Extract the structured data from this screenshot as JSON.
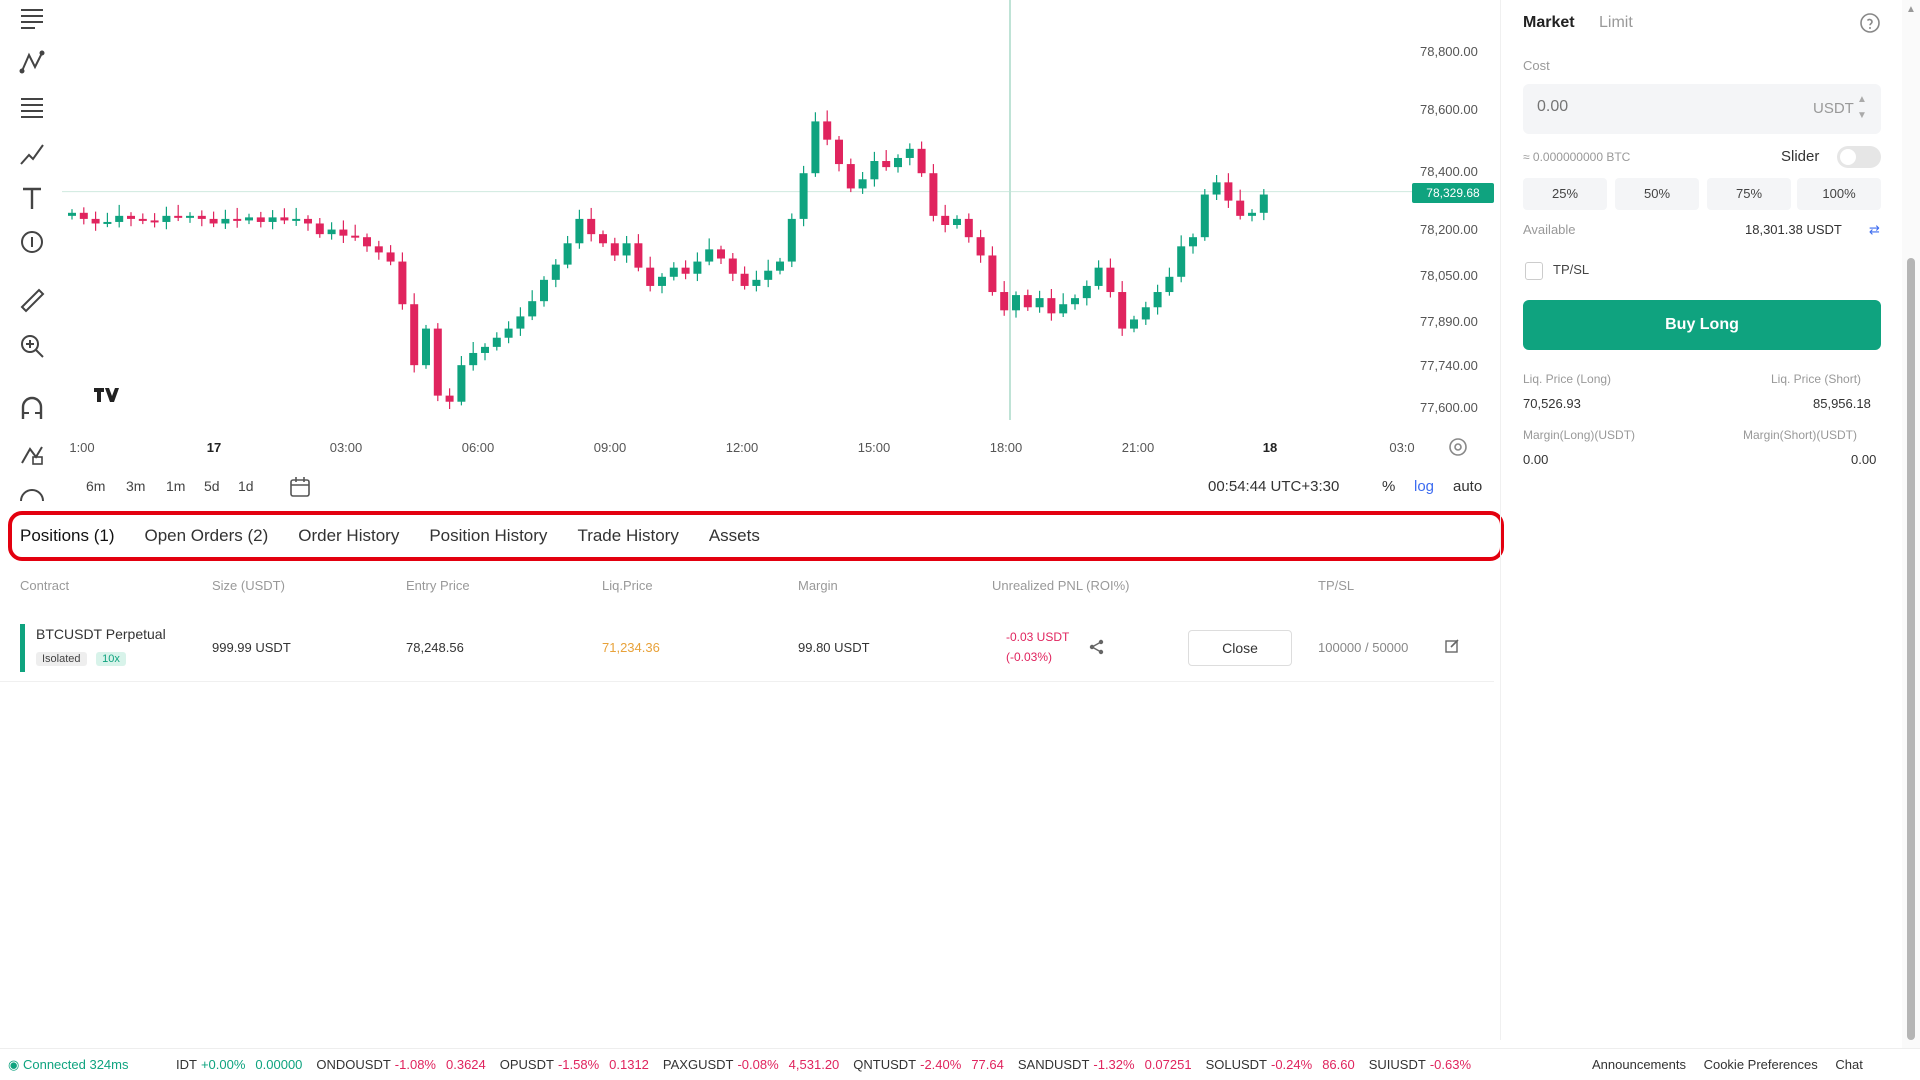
{
  "chart": {
    "price_labels": [
      "78,800.00",
      "78,600.00",
      "78,400.00",
      "78,200.00",
      "78,050.00",
      "77,890.00",
      "77,740.00",
      "77,600.00"
    ],
    "current_price": "78,329.68",
    "time_labels": [
      "1:00",
      "17",
      "03:00",
      "06:00",
      "09:00",
      "12:00",
      "15:00",
      "18:00",
      "21:00",
      "18",
      "03:0"
    ],
    "bold_time_labels": [
      "17",
      "18"
    ],
    "candles_close": [
      78260,
      78240,
      78225,
      78230,
      78250,
      78240,
      78235,
      78230,
      78250,
      78245,
      78250,
      78240,
      78225,
      78240,
      78235,
      78245,
      78230,
      78245,
      78235,
      78240,
      78225,
      78190,
      78205,
      78185,
      78180,
      78150,
      78130,
      78100,
      77960,
      77760,
      77880,
      77660,
      77640,
      77760,
      77800,
      77820,
      77850,
      77880,
      77920,
      77970,
      78040,
      78090,
      78160,
      78240,
      78190,
      78160,
      78120,
      78160,
      78080,
      78020,
      78050,
      78080,
      78060,
      78100,
      78140,
      78110,
      78060,
      78020,
      78040,
      78070,
      78100,
      78240,
      78390,
      78560,
      78500,
      78420,
      78340,
      78370,
      78430,
      78410,
      78440,
      78470,
      78390,
      78250,
      78220,
      78240,
      78180,
      78120,
      78000,
      77940,
      77990,
      77950,
      77980,
      77930,
      77960,
      77980,
      78020,
      78080,
      78000,
      77880,
      77910,
      77950,
      78000,
      78050,
      78150,
      78180,
      78320,
      78360,
      78300,
      78250,
      78260,
      78320
    ],
    "chart_type": "candlestick"
  },
  "time_ranges": [
    "6m",
    "3m",
    "1m",
    "5d",
    "1d"
  ],
  "clock": "00:54:44 UTC+3:30",
  "scale_options": {
    "percent": "%",
    "log": "log",
    "auto": "auto"
  },
  "tabs": [
    {
      "label": "Positions (1)",
      "active": true
    },
    {
      "label": "Open Orders (2)",
      "active": false
    },
    {
      "label": "Order History",
      "active": false
    },
    {
      "label": "Position History",
      "active": false
    },
    {
      "label": "Trade History",
      "active": false
    },
    {
      "label": "Assets",
      "active": false
    }
  ],
  "positions": {
    "columns": [
      "Contract",
      "Size (USDT)",
      "Entry Price",
      "Liq.Price",
      "Margin",
      "Unrealized PNL (ROI%)",
      "TP/SL"
    ],
    "rows": [
      {
        "contract": "BTCUSDT Perpetual",
        "margin_mode": "Isolated",
        "leverage": "10x",
        "size": "999.99 USDT",
        "entry_price": "78,248.56",
        "liq_price": "71,234.36",
        "margin": "99.80 USDT",
        "pnl": "-0.03 USDT",
        "roi": "(-0.03%)",
        "close_label": "Close",
        "tpsl": "100000 / 50000"
      }
    ]
  },
  "order_panel": {
    "order_types": [
      "Market",
      "Limit"
    ],
    "cost_label": "Cost",
    "cost_placeholder": "0.00",
    "cost_unit": "USDT",
    "approx_btc": "≈ 0.000000000 BTC",
    "slider_label": "Slider",
    "percent_buttons": [
      "25%",
      "50%",
      "75%",
      "100%"
    ],
    "available_label": "Available",
    "available_value": "18,301.38 USDT",
    "tpsl_label": "TP/SL",
    "buy_label": "Buy Long",
    "liq_long_label": "Liq. Price (Long)",
    "liq_long_value": "70,526.93",
    "liq_short_label": "Liq. Price (Short)",
    "liq_short_value": "85,956.18",
    "margin_long_label": "Margin(Long)(USDT)",
    "margin_long_value": "0.00",
    "margin_short_label": "Margin(Short)(USDT)",
    "margin_short_value": "0.00"
  },
  "footer": {
    "connection": "Connected 324ms",
    "ticker": [
      {
        "symbol": "IDT",
        "change": "+0.00%",
        "price": "0.00000",
        "up": true
      },
      {
        "symbol": "ONDOUSDT",
        "change": "-1.08%",
        "price": "0.3624",
        "up": false
      },
      {
        "symbol": "OPUSDT",
        "change": "-1.58%",
        "price": "0.1312",
        "up": false
      },
      {
        "symbol": "PAXGUSDT",
        "change": "-0.08%",
        "price": "4,531.20",
        "up": false
      },
      {
        "symbol": "QNTUSDT",
        "change": "-2.40%",
        "price": "77.64",
        "up": false
      },
      {
        "symbol": "SANDUSDT",
        "change": "-1.32%",
        "price": "0.07251",
        "up": false
      },
      {
        "symbol": "SOLUSDT",
        "change": "-0.24%",
        "price": "86.60",
        "up": false
      },
      {
        "symbol": "SUIUSDT",
        "change": "-0.63%",
        "price": "",
        "up": false
      }
    ],
    "links": [
      "Announcements",
      "Cookie Preferences",
      "Chat"
    ]
  },
  "colors": {
    "up": "#0fa37f",
    "down": "#e0245e",
    "highlight_border": "#e3000f",
    "accent_blue": "#3d6cf0"
  }
}
